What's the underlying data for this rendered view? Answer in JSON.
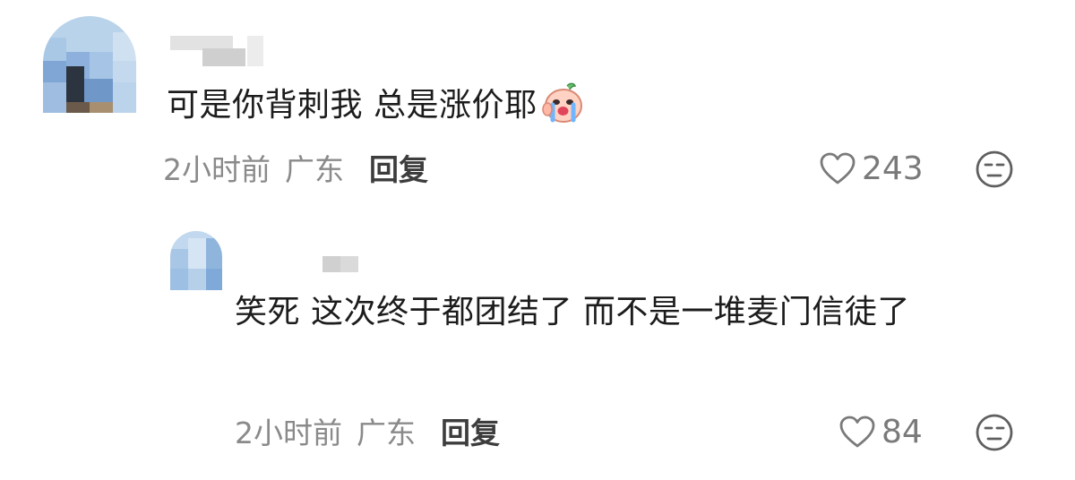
{
  "comments": [
    {
      "text": "可是你背刺我 总是涨价耶",
      "emoji_icon": "crying-face-sticker-icon",
      "time": "2小时前",
      "location": "广东",
      "reply_label": "回复",
      "likes": "243",
      "like_icon": "heart-outline-icon",
      "dislike_icon": "unamused-face-icon"
    },
    {
      "text": "笑死 这次终于都团结了 而不是一堆麦门信徒了",
      "time": "2小时前",
      "location": "广东",
      "reply_label": "回复",
      "likes": "84",
      "like_icon": "heart-outline-icon",
      "dislike_icon": "unamused-face-icon"
    }
  ],
  "colors": {
    "text": "#1c1c1c",
    "meta": "#8a8a8a",
    "reply": "#3d3d3d",
    "icon": "#7a7a7a"
  }
}
